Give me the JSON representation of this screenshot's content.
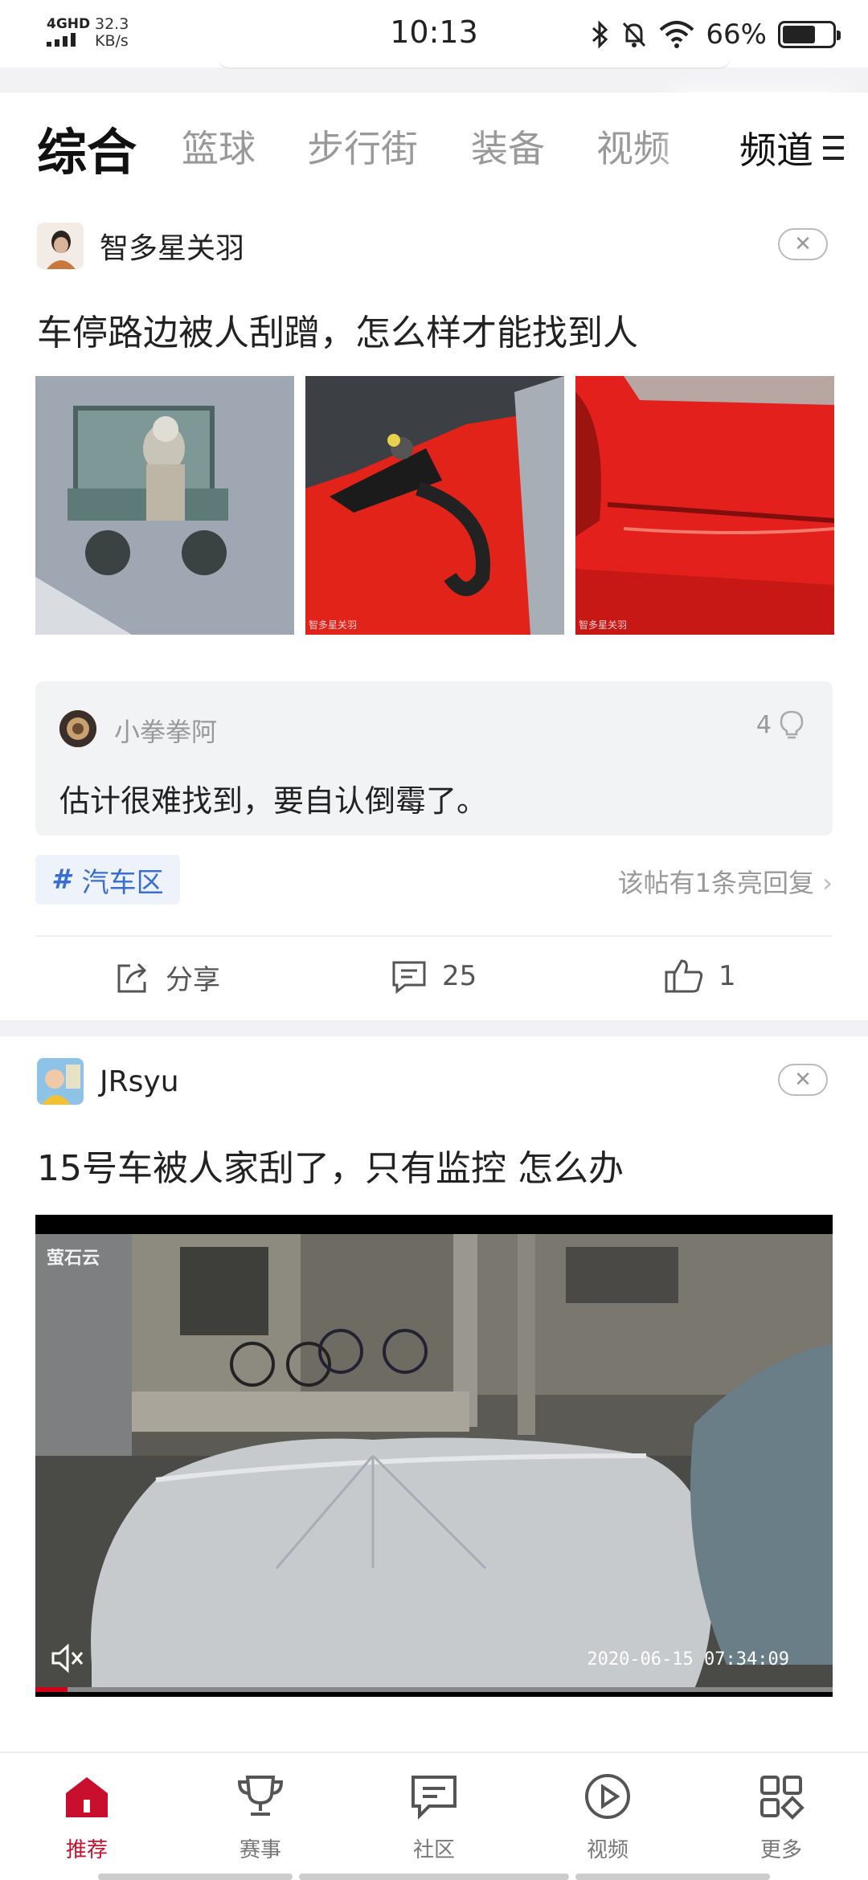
{
  "status_bar": {
    "network": "4GHD",
    "speed_value": "32.3",
    "speed_unit": "KB/s",
    "time": "10:13",
    "battery_text": "66%",
    "battery_level": 0.66,
    "icons": [
      "signal-icon",
      "bluetooth-icon",
      "mute-bell-icon",
      "wifi-icon",
      "battery-icon"
    ]
  },
  "tabs": {
    "items": [
      "综合",
      "篮球",
      "步行街",
      "装备",
      "视频"
    ],
    "active_index": 0,
    "channel_label": "频道"
  },
  "posts": [
    {
      "author": "智多星关羽",
      "title": "车停路边被人刮蹭，怎么样才能找到人",
      "image_watermarks": [
        "",
        "智多星关羽",
        "智多星关羽"
      ],
      "top_comment": {
        "user": "小拳拳阿",
        "likes": "4",
        "text": "估计很难找到，要自认倒霉了。"
      },
      "tag": "汽车区",
      "hot_reply_text": "该帖有1条亮回复",
      "actions": {
        "share": "分享",
        "comments": "25",
        "likes": "1"
      }
    },
    {
      "author": "JRsyu",
      "title": "15号车被人家刮了，只有监控 怎么办",
      "video": {
        "watermark": "萤石云",
        "timestamp": "2020-06-15 07:34:09",
        "progress": 0.04
      }
    }
  ],
  "bottom_nav": {
    "items": [
      {
        "label": "推荐",
        "icon": "home-icon"
      },
      {
        "label": "赛事",
        "icon": "trophy-icon"
      },
      {
        "label": "社区",
        "icon": "chat-icon"
      },
      {
        "label": "视频",
        "icon": "play-icon"
      },
      {
        "label": "更多",
        "icon": "grid-icon"
      }
    ],
    "active_index": 0
  },
  "colors": {
    "accent": "#c8102e",
    "tag_blue": "#3a6fd0"
  }
}
